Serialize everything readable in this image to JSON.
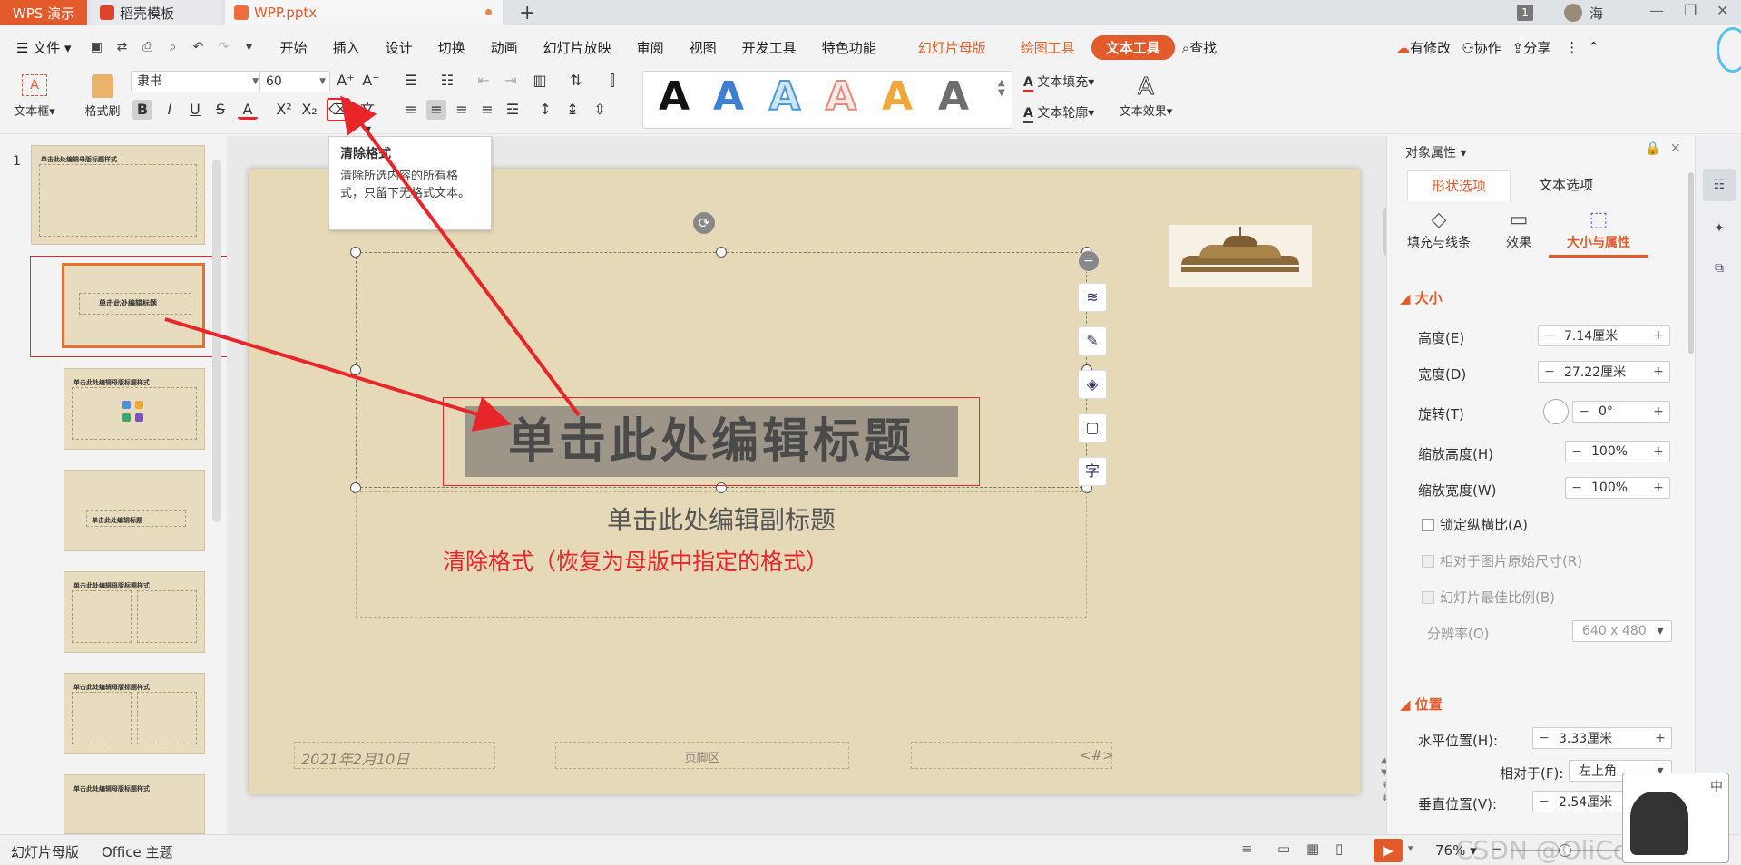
{
  "tabs": {
    "app": "WPS 演示",
    "template": "稻壳模板",
    "file": "WPP.pptx",
    "badge": "1",
    "user": "海"
  },
  "menu": {
    "file": "文件",
    "items": [
      "开始",
      "插入",
      "设计",
      "切换",
      "动画",
      "幻灯片放映",
      "审阅",
      "视图",
      "开发工具",
      "特色功能"
    ],
    "master": "幻灯片母版",
    "draw": "绘图工具",
    "text_tool": "文本工具",
    "search": "查找",
    "modified": "有修改",
    "collab": "协作",
    "share": "分享"
  },
  "ribbon": {
    "textbox": "文本框",
    "format_painter": "格式刷",
    "font": "隶书",
    "size": "60",
    "text_fill": "文本填充",
    "text_outline": "文本轮廓",
    "text_effect": "文本效果",
    "wordart_glyph": "A",
    "phonetic": "文"
  },
  "tooltip": {
    "title": "清除格式",
    "body": "清除所选内容的所有格式，只留下无格式文本。"
  },
  "thumbnails": {
    "num": "1",
    "title1": "单击此处编辑母版标题样式",
    "title2": "单击此处编辑标题",
    "title3": "单击此处编辑母版标题样式",
    "title4": "单击此处编辑标题"
  },
  "slide": {
    "title": "单击此处编辑标题",
    "subtitle": "单击此处编辑副标题",
    "annotation": "清除格式（恢复为母版中指定的格式）",
    "date": "2021年2月10日",
    "footer": "页脚区",
    "pagenum": "<#>"
  },
  "panel": {
    "title": "对象属性",
    "tab_shape": "形状选项",
    "tab_text": "文本选项",
    "sub_fill": "填充与线条",
    "sub_effect": "效果",
    "sub_size": "大小与属性",
    "sec_size": "大小",
    "height_label": "高度(E)",
    "height_val": "7.14厘米",
    "width_label": "宽度(D)",
    "width_val": "27.22厘米",
    "rotate_label": "旋转(T)",
    "rotate_val": "0°",
    "scale_h_label": "缩放高度(H)",
    "scale_h_val": "100%",
    "scale_w_label": "缩放宽度(W)",
    "scale_w_val": "100%",
    "lock_ratio": "锁定纵横比(A)",
    "relative_orig": "相对于图片原始尺寸(R)",
    "best_scale": "幻灯片最佳比例(B)",
    "resolution_label": "分辨率(O)",
    "resolution_val": "640 x 480",
    "sec_pos": "位置",
    "hpos_label": "水平位置(H):",
    "hpos_val": "3.33厘米",
    "relative_to": "相对于(F):",
    "relative_val": "左上角",
    "vpos_label": "垂直位置(V):",
    "vpos_val": "2.54厘米"
  },
  "status": {
    "mode": "幻灯片母版",
    "theme": "Office 主题",
    "zoom": "76%",
    "ime": "中",
    "watermark": "CSDN @OliConnect"
  },
  "colors": {
    "accent": "#e35b2b",
    "arrow": "#e8262a",
    "slide_bg": "#e5d9b8"
  }
}
